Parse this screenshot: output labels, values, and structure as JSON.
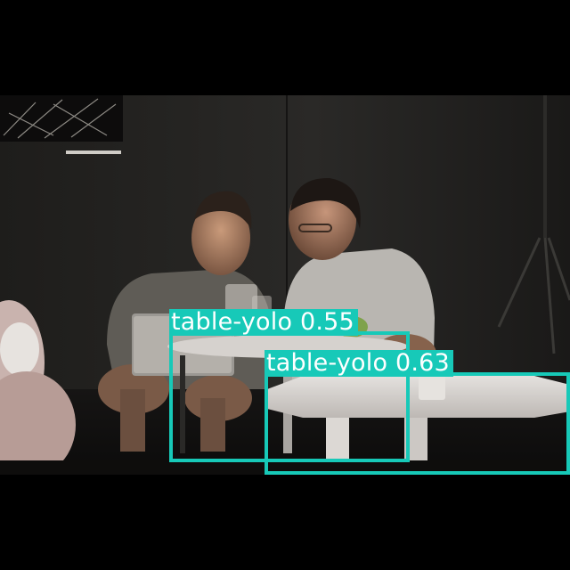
{
  "detections": [
    {
      "label": "table-yolo",
      "score": "0.55"
    },
    {
      "label": "table-yolo",
      "score": "0.63"
    }
  ],
  "colors": {
    "box": "#17c9b8",
    "label_text": "#ffffff",
    "letterbox": "#000000"
  }
}
